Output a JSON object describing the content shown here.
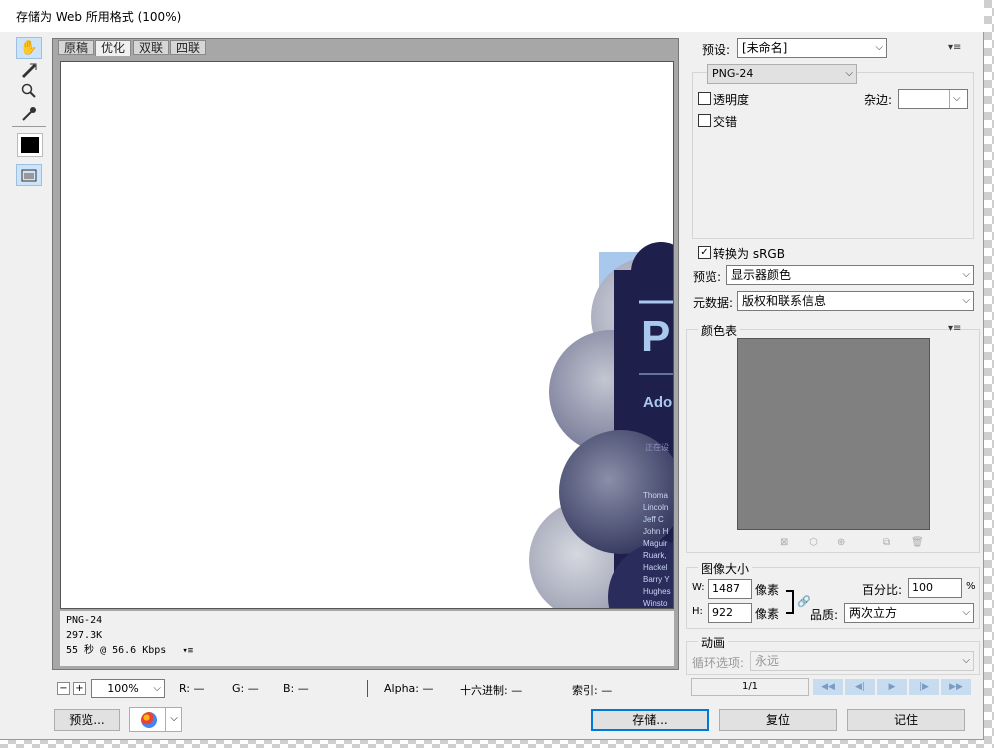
{
  "window": {
    "title": "存储为 Web 所用格式 (100%)"
  },
  "tabs": [
    "原稿",
    "优化",
    "双联",
    "四联"
  ],
  "info": {
    "format": "PNG-24",
    "size": "297.3K",
    "time": "55 秒 @ 56.6 Kbps"
  },
  "artwork": {
    "letter": "P",
    "ado": "Ado",
    "small": "正在设",
    "names": [
      "Thoma",
      "Lincoln",
      "Jeff C",
      "John H",
      "Maguir",
      "Ruark,",
      "Hackel",
      "Barry Y",
      "Hughes",
      "Winsto"
    ]
  },
  "statusbar": {
    "zoom": "100%",
    "r": "R: —",
    "g": "G: —",
    "b": "B: —",
    "alpha": "Alpha: —",
    "hex": "十六进制: —",
    "index": "索引: —"
  },
  "buttons": {
    "preview": "预览...",
    "save": "存储...",
    "reset": "复位",
    "remember": "记住"
  },
  "right": {
    "preset_label": "预设:",
    "preset_value": "[未命名]",
    "format_value": "PNG-24",
    "transparency": "透明度",
    "matte_label": "杂边:",
    "interlaced": "交错",
    "convert_srgb": "转换为 sRGB",
    "preview_label": "预览:",
    "preview_value": "显示器颜色",
    "metadata_label": "元数据:",
    "metadata_value": "版权和联系信息",
    "color_table": "颜色表",
    "image_size": "图像大小",
    "w_label": "W:",
    "w_value": "1487",
    "h_label": "H:",
    "h_value": "922",
    "px": "像素",
    "percent_label": "百分比:",
    "percent_value": "100",
    "percent_sign": "%",
    "quality_label": "品质:",
    "quality_value": "两次立方",
    "animation": "动画",
    "loop_label": "循环选项:",
    "loop_value": "永远",
    "frame": "1/1"
  },
  "state": {
    "transparency_checked": false,
    "interlaced_checked": false,
    "srgb_checked": true
  },
  "colors": {
    "accent": "#0078d7",
    "artwork_navy": "#1e1f4b",
    "artwork_blue": "#a9c8ee",
    "color_table_bg": "#808080"
  }
}
